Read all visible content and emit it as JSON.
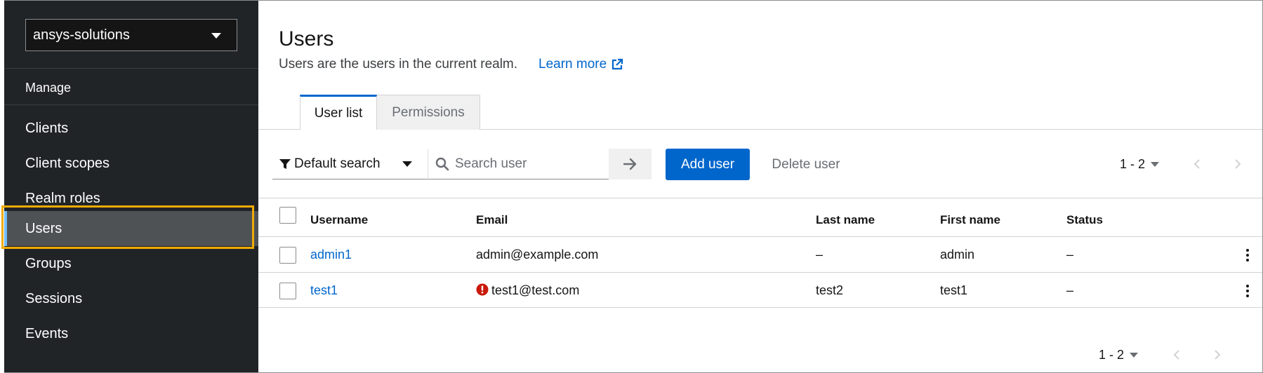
{
  "sidebar": {
    "realm": "ansys-solutions",
    "section_label": "Manage",
    "items": [
      {
        "label": "Clients"
      },
      {
        "label": "Client scopes"
      },
      {
        "label": "Realm roles"
      },
      {
        "label": "Users",
        "active": true
      },
      {
        "label": "Groups"
      },
      {
        "label": "Sessions"
      },
      {
        "label": "Events"
      }
    ]
  },
  "header": {
    "title": "Users",
    "description": "Users are the users in the current realm.",
    "learn_more": "Learn more"
  },
  "tabs": [
    {
      "label": "User list",
      "active": true
    },
    {
      "label": "Permissions",
      "active": false
    }
  ],
  "toolbar": {
    "filter_label": "Default search",
    "search_placeholder": "Search user",
    "add_label": "Add user",
    "delete_label": "Delete user",
    "pagination_top": "1 - 2"
  },
  "table": {
    "columns": [
      "Username",
      "Email",
      "Last name",
      "First name",
      "Status"
    ],
    "rows": [
      {
        "username": "admin1",
        "email": "admin@example.com",
        "email_warning": false,
        "last_name": "–",
        "first_name": "admin",
        "status": "–"
      },
      {
        "username": "test1",
        "email": "test1@test.com",
        "email_warning": true,
        "last_name": "test2",
        "first_name": "test1",
        "status": "–"
      }
    ]
  },
  "footer": {
    "pagination_bottom": "1 - 2"
  },
  "colors": {
    "sidebar_bg": "#212427",
    "accent": "#0066cc",
    "highlight": "#f0ab00",
    "warning": "#c9190b"
  }
}
